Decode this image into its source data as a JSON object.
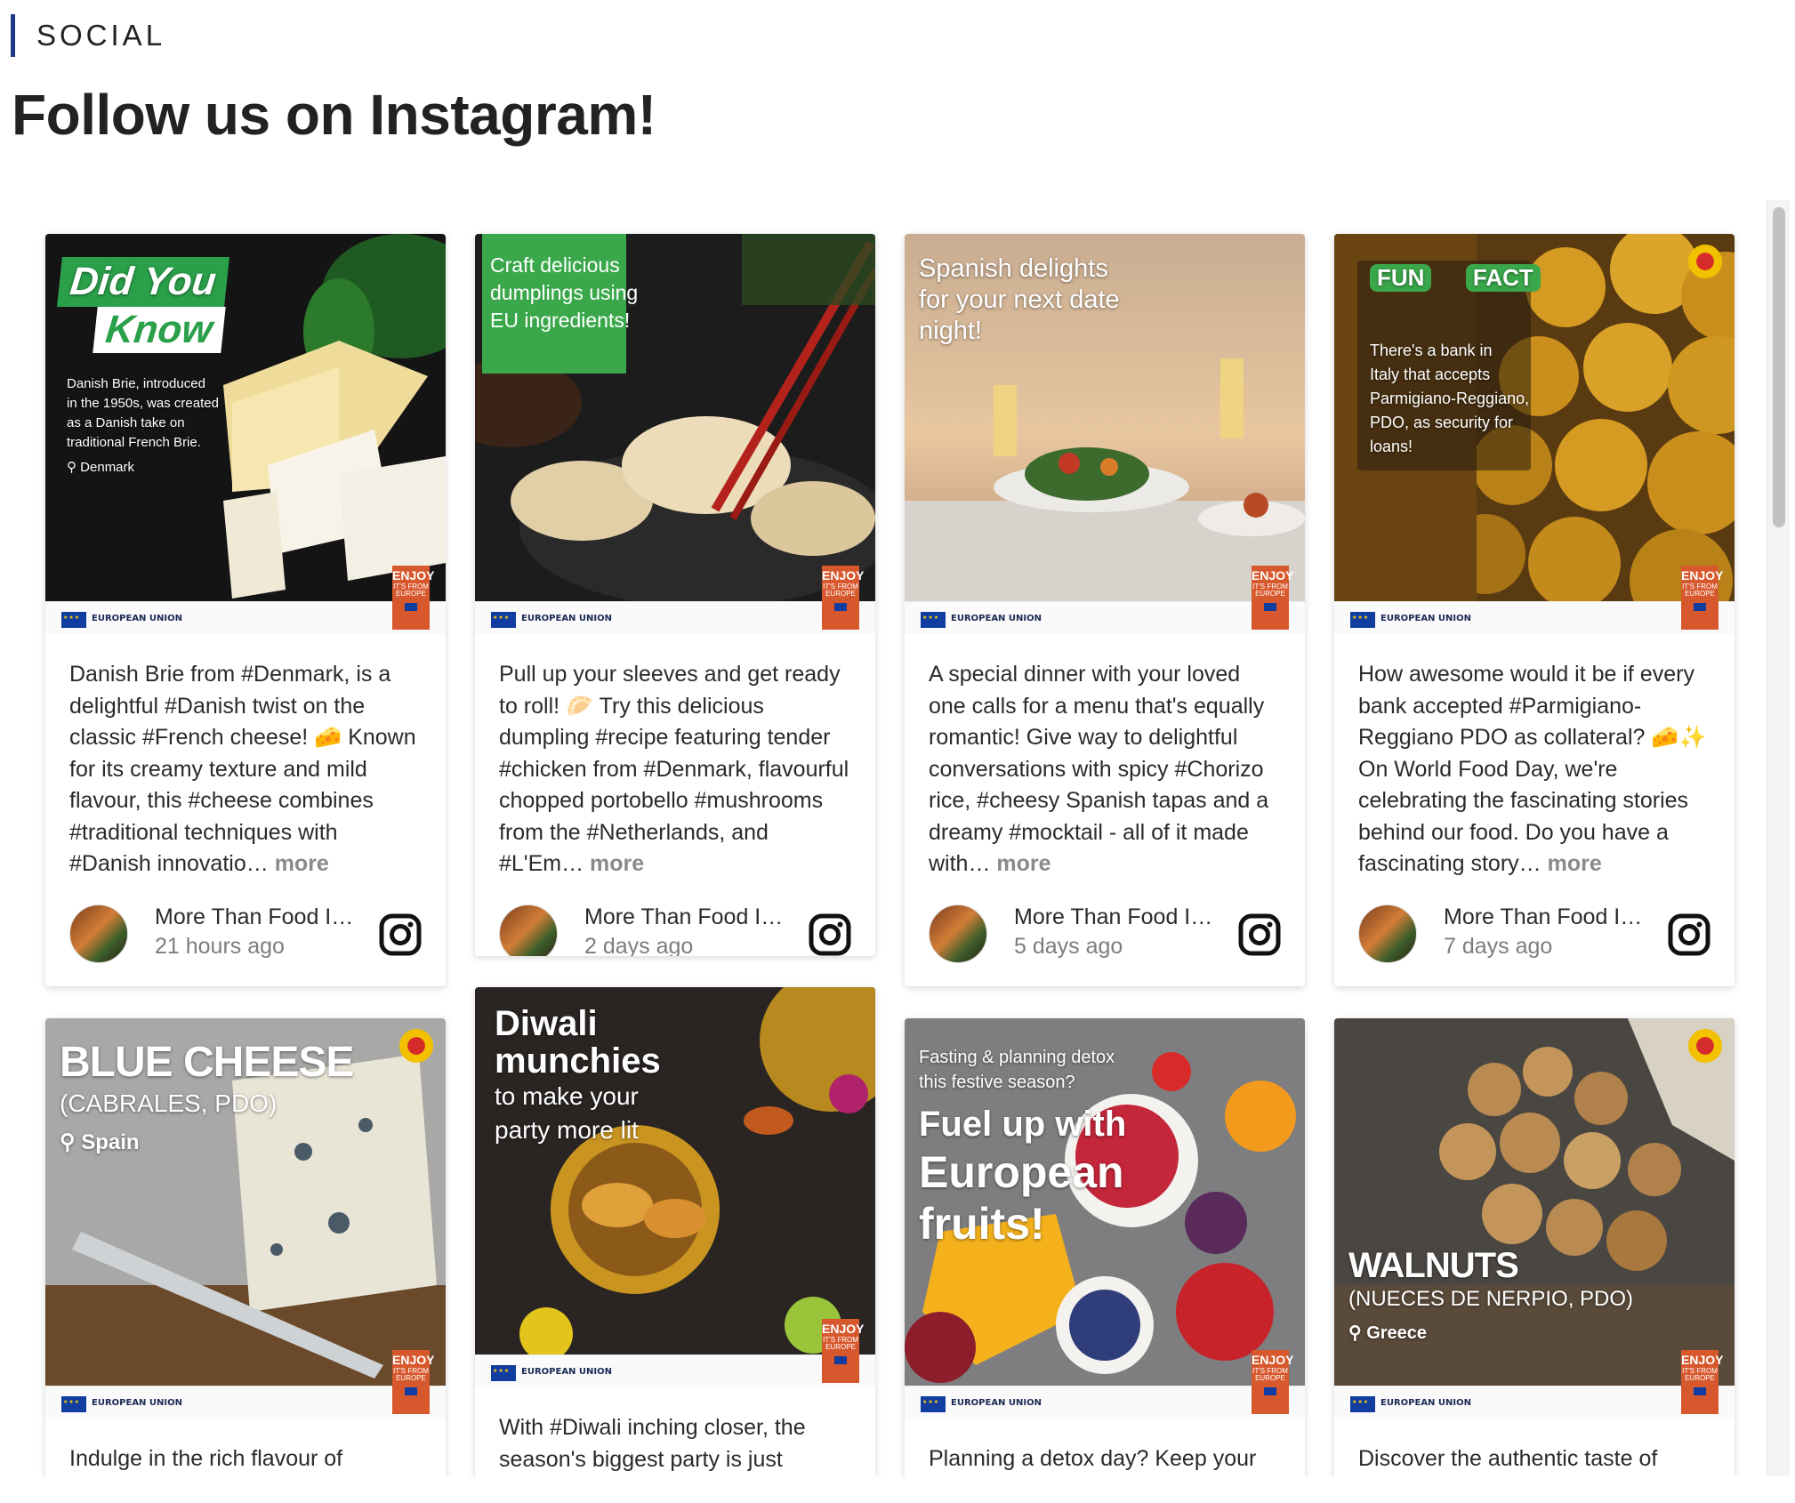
{
  "section": {
    "label": "SOCIAL"
  },
  "page": {
    "title": "Follow us on Instagram!"
  },
  "brand": {
    "eu_label": "EUROPEAN UNION",
    "enjoy_big": "ENJOY",
    "enjoy_small": "IT'S FROM EUROPE",
    "more_label": "more"
  },
  "posts": [
    {
      "overlay": {
        "headline": [
          "Did You",
          "Know"
        ],
        "body": [
          "Danish Brie, introduced",
          "in the 1950s, was created",
          "as a Danish take on",
          "traditional French Brie."
        ],
        "location": "Denmark"
      },
      "caption": "Danish Brie from #Denmark, is a delightful #Danish twist on the classic #French cheese! 🧀 Known for its creamy texture and mild flavour, this #cheese combines #traditional techniques with #Danish innovatio…",
      "author": "More Than Food I…",
      "time": "21 hours ago"
    },
    {
      "overlay": {
        "lines": [
          "Craft delicious",
          "dumplings using",
          "EU ingredients!"
        ]
      },
      "caption": "Pull up your sleeves and get ready to roll! 🥟 Try this delicious dumpling #recipe featuring tender #chicken from #Denmark, flavourful chopped portobello #mushrooms from the #Netherlands, and #L'Em…",
      "author": "More Than Food I…",
      "time": "2 days ago"
    },
    {
      "overlay": {
        "lines": [
          "Spanish delights",
          "for your next date",
          "night!"
        ]
      },
      "caption": "A special dinner with your loved one calls for a menu that's equally romantic! Give way to delightful conversations with spicy #Chorizo rice, #cheesy Spanish tapas and a dreamy #mocktail - all of it made with…",
      "author": "More Than Food I…",
      "time": "5 days ago"
    },
    {
      "overlay": {
        "headline": [
          "FUN",
          "FACT"
        ],
        "lines": [
          "There's a bank in",
          "Italy that accepts",
          "Parmigiano-Reggiano,",
          "PDO, as security for",
          "loans!"
        ]
      },
      "caption": "How awesome would it be if every bank accepted #Parmigiano-Reggiano PDO as collateral? 🧀✨ On World Food Day, we're celebrating the fascinating stories behind our food. Do you have a fascinating story…",
      "author": "More Than Food I…",
      "time": "7 days ago"
    },
    {
      "overlay": {
        "headline": "BLUE CHEESE",
        "sub": "(CABRALES, PDO)",
        "location": "Spain"
      },
      "caption": "Indulge in the rich flavour of Cabrales"
    },
    {
      "overlay": {
        "headline": [
          "Diwali",
          "munchies"
        ],
        "lines": [
          "to make your",
          "party more lit"
        ]
      },
      "caption": "With #Diwali inching closer, the season's biggest party is just around"
    },
    {
      "overlay": {
        "pre": [
          "Fasting & planning detox",
          "this festive season?"
        ],
        "headline": [
          "Fuel up with",
          "European",
          "fruits!"
        ]
      },
      "caption": "Planning a detox day? Keep your"
    },
    {
      "overlay": {
        "headline": "WALNUTS",
        "sub": "(NUECES DE NERPIO, PDO)",
        "location": "Greece"
      },
      "caption": "Discover the authentic taste of"
    }
  ]
}
